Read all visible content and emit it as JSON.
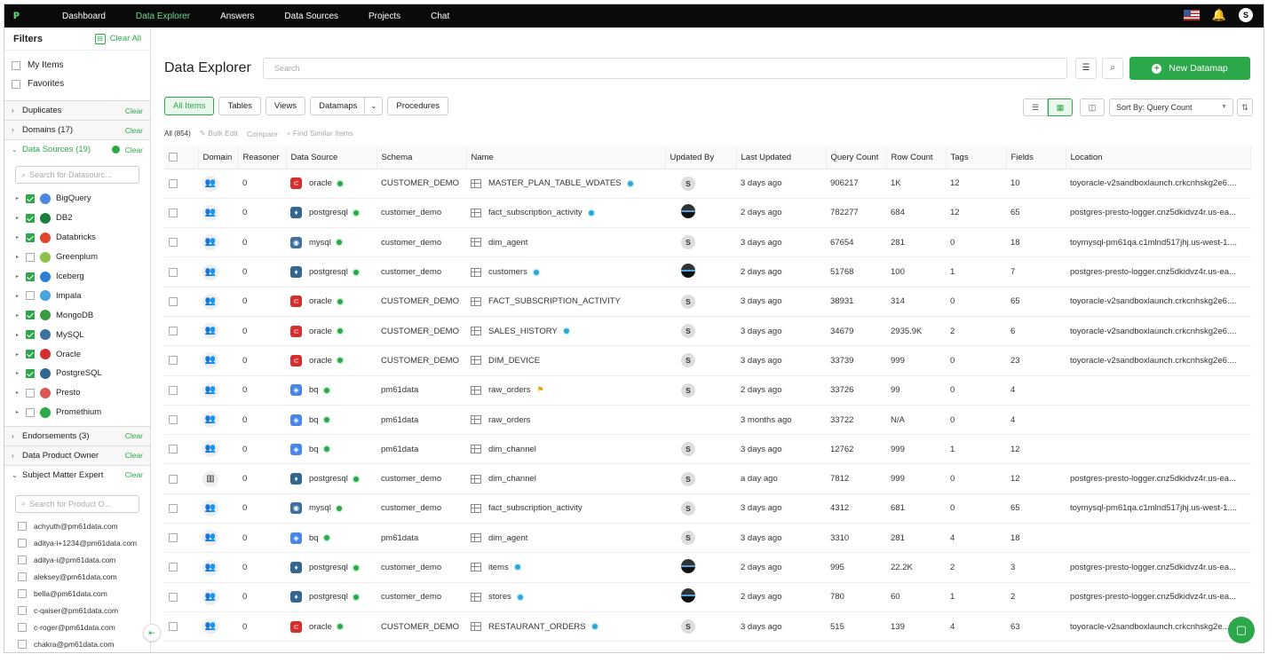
{
  "nav": {
    "items": [
      "Dashboard",
      "Data Explorer",
      "Answers",
      "Data Sources",
      "Projects",
      "Chat"
    ],
    "avatar_initial": "S"
  },
  "filters": {
    "title": "Filters",
    "clear_all": "Clear All",
    "my_items": "My Items",
    "favorites": "Favorites",
    "clear": "Clear",
    "sections": {
      "duplicates": "Duplicates",
      "domains": "Domains (17)",
      "data_sources": "Data Sources (19)",
      "endorsements": "Endorsements (3)",
      "data_product_owner": "Data Product Owner",
      "sme": "Subject Matter Expert"
    },
    "ds_search_placeholder": "Search for Datasourc...",
    "datasources": [
      {
        "name": "BigQuery",
        "checked": true,
        "color": "#4a86e8"
      },
      {
        "name": "DB2",
        "checked": true,
        "color": "#1a7f3c"
      },
      {
        "name": "Databricks",
        "checked": true,
        "color": "#e0442b"
      },
      {
        "name": "Greenplum",
        "checked": false,
        "color": "#8bc34a"
      },
      {
        "name": "Iceberg",
        "checked": true,
        "color": "#2d7fd3"
      },
      {
        "name": "Impala",
        "checked": false,
        "color": "#4aa3df"
      },
      {
        "name": "MongoDB",
        "checked": true,
        "color": "#3b9b3f"
      },
      {
        "name": "MySQL",
        "checked": true,
        "color": "#3f6f9e"
      },
      {
        "name": "Oracle",
        "checked": true,
        "color": "#d32f2f"
      },
      {
        "name": "PostgreSQL",
        "checked": true,
        "color": "#336791"
      },
      {
        "name": "Presto",
        "checked": false,
        "color": "#d55"
      },
      {
        "name": "Promethium",
        "checked": false,
        "color": "#2aa84a"
      }
    ],
    "sme_search_placeholder": "Search for Product O...",
    "sme_users": [
      "achyuth@pm61data.com",
      "aditya-i+1234@pm61data.com",
      "aditya-i@pm61data.com",
      "aleksey@pm61data.com",
      "bella@pm61data.com",
      "c-qaiser@pm61data.com",
      "c-roger@pm61data.com",
      "chakra@pm61data.com"
    ]
  },
  "main": {
    "title": "Data Explorer",
    "search_placeholder": "Search",
    "new_button": "New Datamap",
    "tabs": [
      "All Items",
      "Tables",
      "Views",
      "Datamaps",
      "Procedures"
    ],
    "sort_label": "Sort By: Query Count",
    "actions": {
      "all": "All (854)",
      "bulk_edit": "Bulk Edit",
      "compare": "Compare",
      "find_similar": "Find Similar Items"
    },
    "columns": [
      "Domain",
      "Reasoner",
      "Data Source",
      "Schema",
      "Name",
      "Updated By",
      "Last Updated",
      "Query Count",
      "Row Count",
      "Tags",
      "Fields",
      "Location"
    ],
    "rows": [
      {
        "reasoner": "0",
        "ds": "oracle",
        "schema": "CUSTOMER_DEMO",
        "name": "MASTER_PLAN_TABLE_WDATES",
        "badge": "dot",
        "updated_by": "S",
        "last": "3 days ago",
        "qc": "906217",
        "rc": "1K",
        "tags": "12",
        "fields": "10",
        "loc": "toyoracle-v2sandboxlaunch.crkcnhskg2e6...."
      },
      {
        "reasoner": "0",
        "ds": "postgresql",
        "schema": "customer_demo",
        "name": "fact_subscription_activity",
        "badge": "dot",
        "updated_by": "dark",
        "last": "2 days ago",
        "qc": "782277",
        "rc": "684",
        "tags": "12",
        "fields": "65",
        "loc": "postgres-presto-logger.cnz5dkidvz4r.us-ea..."
      },
      {
        "reasoner": "0",
        "ds": "mysql",
        "schema": "customer_demo",
        "name": "dim_agent",
        "badge": "",
        "updated_by": "S",
        "last": "3 days ago",
        "qc": "67654",
        "rc": "281",
        "tags": "0",
        "fields": "18",
        "loc": "toymysql-pm61qa.c1mlnd517jhj.us-west-1...."
      },
      {
        "reasoner": "0",
        "ds": "postgresql",
        "schema": "customer_demo",
        "name": "customers",
        "badge": "dot",
        "updated_by": "dark",
        "last": "2 days ago",
        "qc": "51768",
        "rc": "100",
        "tags": "1",
        "fields": "7",
        "loc": "postgres-presto-logger.cnz5dkidvz4r.us-ea..."
      },
      {
        "reasoner": "0",
        "ds": "oracle",
        "schema": "CUSTOMER_DEMO",
        "name": "FACT_SUBSCRIPTION_ACTIVITY",
        "badge": "",
        "updated_by": "S",
        "last": "3 days ago",
        "qc": "38931",
        "rc": "314",
        "tags": "0",
        "fields": "65",
        "loc": "toyoracle-v2sandboxlaunch.crkcnhskg2e6...."
      },
      {
        "reasoner": "0",
        "ds": "oracle",
        "schema": "CUSTOMER_DEMO",
        "name": "SALES_HISTORY",
        "badge": "dot",
        "updated_by": "S",
        "last": "3 days ago",
        "qc": "34679",
        "rc": "2935.9K",
        "tags": "2",
        "fields": "6",
        "loc": "toyoracle-v2sandboxlaunch.crkcnhskg2e6...."
      },
      {
        "reasoner": "0",
        "ds": "oracle",
        "schema": "CUSTOMER_DEMO",
        "name": "DIM_DEVICE",
        "badge": "",
        "updated_by": "S",
        "last": "3 days ago",
        "qc": "33739",
        "rc": "999",
        "tags": "0",
        "fields": "23",
        "loc": "toyoracle-v2sandboxlaunch.crkcnhskg2e6...."
      },
      {
        "reasoner": "0",
        "ds": "bq",
        "schema": "pm61data",
        "name": "raw_orders",
        "badge": "flag",
        "updated_by": "S",
        "last": "2 days ago",
        "qc": "33726",
        "rc": "99",
        "tags": "0",
        "fields": "4",
        "loc": ""
      },
      {
        "reasoner": "0",
        "ds": "bq",
        "schema": "pm61data",
        "name": "raw_orders",
        "badge": "",
        "updated_by": "",
        "last": "3 months ago",
        "qc": "33722",
        "rc": "N/A",
        "tags": "0",
        "fields": "4",
        "loc": ""
      },
      {
        "reasoner": "0",
        "ds": "bq",
        "schema": "pm61data",
        "name": "dim_channel",
        "badge": "",
        "updated_by": "S",
        "last": "3 days ago",
        "qc": "12762",
        "rc": "999",
        "tags": "1",
        "fields": "12",
        "loc": ""
      },
      {
        "reasoner": "0",
        "ds": "postgresql",
        "schema": "customer_demo",
        "name": "dim_channel",
        "badge": "",
        "updated_by": "S",
        "last": "a day ago",
        "qc": "7812",
        "rc": "999",
        "tags": "0",
        "fields": "12",
        "loc": "postgres-presto-logger.cnz5dkidvz4r.us-ea..."
      },
      {
        "reasoner": "0",
        "ds": "mysql",
        "schema": "customer_demo",
        "name": "fact_subscription_activity",
        "badge": "",
        "updated_by": "S",
        "last": "3 days ago",
        "qc": "4312",
        "rc": "681",
        "tags": "0",
        "fields": "65",
        "loc": "toymysql-pm61qa.c1mlnd517jhj.us-west-1...."
      },
      {
        "reasoner": "0",
        "ds": "bq",
        "schema": "pm61data",
        "name": "dim_agent",
        "badge": "",
        "updated_by": "S",
        "last": "3 days ago",
        "qc": "3310",
        "rc": "281",
        "tags": "4",
        "fields": "18",
        "loc": ""
      },
      {
        "reasoner": "0",
        "ds": "postgresql",
        "schema": "customer_demo",
        "name": "items",
        "badge": "dot",
        "updated_by": "dark",
        "last": "2 days ago",
        "qc": "995",
        "rc": "22.2K",
        "tags": "2",
        "fields": "3",
        "loc": "postgres-presto-logger.cnz5dkidvz4r.us-ea..."
      },
      {
        "reasoner": "0",
        "ds": "postgresql",
        "schema": "customer_demo",
        "name": "stores",
        "badge": "dot",
        "updated_by": "dark",
        "last": "2 days ago",
        "qc": "780",
        "rc": "60",
        "tags": "1",
        "fields": "2",
        "loc": "postgres-presto-logger.cnz5dkidvz4r.us-ea..."
      },
      {
        "reasoner": "0",
        "ds": "oracle",
        "schema": "CUSTOMER_DEMO",
        "name": "RESTAURANT_ORDERS",
        "badge": "dot",
        "updated_by": "S",
        "last": "3 days ago",
        "qc": "515",
        "rc": "139",
        "tags": "4",
        "fields": "63",
        "loc": "toyoracle-v2sandboxlaunch.crkcnhskg2e..."
      }
    ]
  },
  "colors": {
    "accent": "#2aa84a",
    "topbar": "#0a0a0a"
  }
}
